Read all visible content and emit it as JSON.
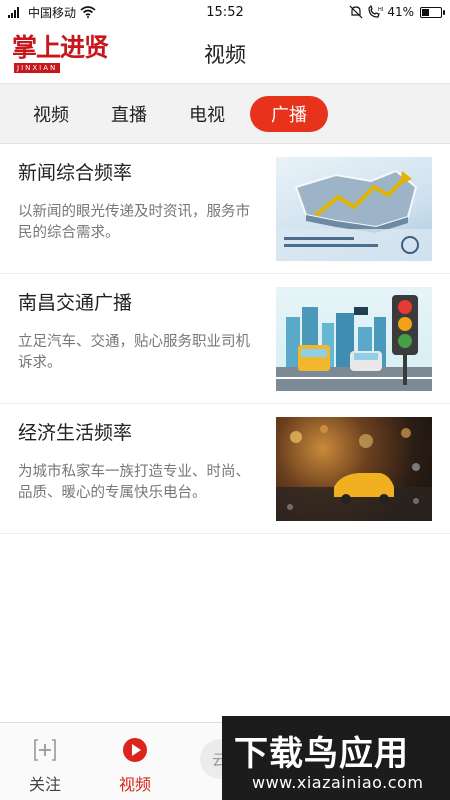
{
  "status_bar": {
    "carrier": "中国移动",
    "time": "15:52",
    "battery": "41%",
    "battery_level": 0.41,
    "signal_label": "4G"
  },
  "header": {
    "logo_text": "掌上进贤",
    "logo_sub": "JINXIAN",
    "title": "视频"
  },
  "tabs": [
    {
      "label": "视频",
      "active": false
    },
    {
      "label": "直播",
      "active": false
    },
    {
      "label": "电视",
      "active": false
    },
    {
      "label": "广播",
      "active": true
    }
  ],
  "items": [
    {
      "title": "新闻综合频率",
      "desc": "以新闻的眼光传递及时资讯，服务市民的综合需求。"
    },
    {
      "title": "南昌交通广播",
      "desc": "立足汽车、交通，贴心服务职业司机诉求。"
    },
    {
      "title": "经济生活频率",
      "desc": "为城市私家车一族打造专业、时尚、品质、暖心的专属快乐电台。"
    }
  ],
  "bottom_nav": [
    {
      "label": "关注",
      "icon": "plus-box-icon",
      "active": false
    },
    {
      "label": "视频",
      "icon": "play-circle-icon",
      "active": true
    }
  ],
  "watermark": {
    "title": "下载鸟应用",
    "url": "www.xiazainiao.com"
  },
  "colors": {
    "accent": "#e8331c",
    "logo": "#c8161d"
  }
}
